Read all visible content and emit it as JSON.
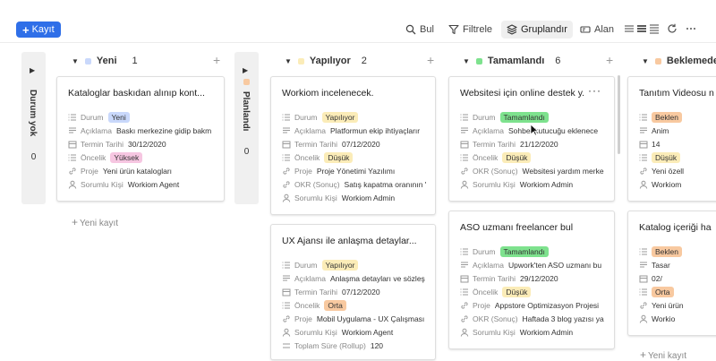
{
  "toolbar": {
    "new_label": "Kayıt",
    "search_label": "Bul",
    "filter_label": "Filtrele",
    "group_label": "Gruplandır",
    "fields_label": "Alan"
  },
  "colors": {
    "accent": "#2f6fe8",
    "badge_yeni": "#c9d8fb",
    "badge_yapiliyor": "#fbecb8",
    "badge_tamamlandi": "#7ee28e",
    "badge_beklemede": "#f8c9a0",
    "badge_yuksek": "#f6c6e1",
    "badge_dusuk": "#fbecb8",
    "badge_orta": "#f8c9a0"
  },
  "columns": {
    "durum_yok": {
      "title": "Durum yok",
      "count": "0"
    },
    "planlandi": {
      "title": "Planlandı",
      "count": "0"
    },
    "yeni": {
      "title": "Yeni",
      "count": "1",
      "new_record": "Yeni kayıt"
    },
    "yapiliyor": {
      "title": "Yapılıyor",
      "count": "2"
    },
    "tamamlandi": {
      "title": "Tamamlandı",
      "count": "6"
    },
    "beklemede": {
      "title": "Beklemede",
      "new_record": "Yeni kayıt"
    }
  },
  "labels": {
    "durum": "Durum",
    "aciklama": "Açıklama",
    "termin": "Termin Tarihi",
    "oncelik": "Öncelik",
    "proje": "Proje",
    "sorumlu": "Sorumlu Kişi",
    "okr": "OKR (Sonuç)",
    "toplam": "Toplam Süre (Rollup)"
  },
  "cards": {
    "c1": {
      "title": "Kataloglar baskıdan alınıp kont...",
      "durum": "Yeni",
      "aciklama": "Baskı merkezine gidip bakm",
      "termin": "30/12/2020",
      "oncelik": "Yüksek",
      "proje": "Yeni ürün katalogları",
      "sorumlu": "Workiom Agent"
    },
    "c2": {
      "title": "Workiom incelenecek.",
      "durum": "Yapılıyor",
      "aciklama": "Platformun ekip ihtiyaçlarır",
      "termin": "07/12/2020",
      "oncelik": "Düşük",
      "proje": "Proje Yönetimi Yazılımı",
      "okr": "Satış kapatma oranının '",
      "sorumlu": "Workiom Admin"
    },
    "c3": {
      "title": "UX Ajansı ile anlaşma detaylar...",
      "durum": "Yapılıyor",
      "aciklama": "Anlaşma detayları ve sözleş",
      "termin": "07/12/2020",
      "oncelik": "Orta",
      "proje": "Mobil Uygulama - UX Çalışması",
      "sorumlu": "Workiom Agent",
      "toplam": "120"
    },
    "c4": {
      "title": "Websitesi için online destek y...",
      "durum": "Tamamlandı",
      "aciklama": "Sohbet kutucuğu eklenece",
      "termin": "21/12/2020",
      "oncelik": "Düşük",
      "okr": "Websitesi yardım merke",
      "sorumlu": "Workiom Admin"
    },
    "c5": {
      "title": "ASO uzmanı freelancer bul",
      "durum": "Tamamlandı",
      "aciklama": "Upwork'ten ASO uzmanı bu",
      "termin": "29/12/2020",
      "oncelik": "Düşük",
      "proje": "Appstore Optimizasyon Projesi",
      "okr": "Haftada 3 blog yazısı ya",
      "sorumlu": "Workiom Admin"
    },
    "c6": {
      "title": "Tanıtım Videosu n",
      "durum": "Beklen",
      "aciklama": "Anim",
      "termin": "14",
      "oncelik": "Düşük",
      "proje": "Yeni özell",
      "sorumlu": "Workiom"
    },
    "c7": {
      "title": "Katalog içeriği ha",
      "durum": "Beklen",
      "aciklama": "Tasar",
      "termin": "02/",
      "oncelik": "Orta",
      "proje": "Yeni ürün",
      "sorumlu": "Workio"
    }
  }
}
